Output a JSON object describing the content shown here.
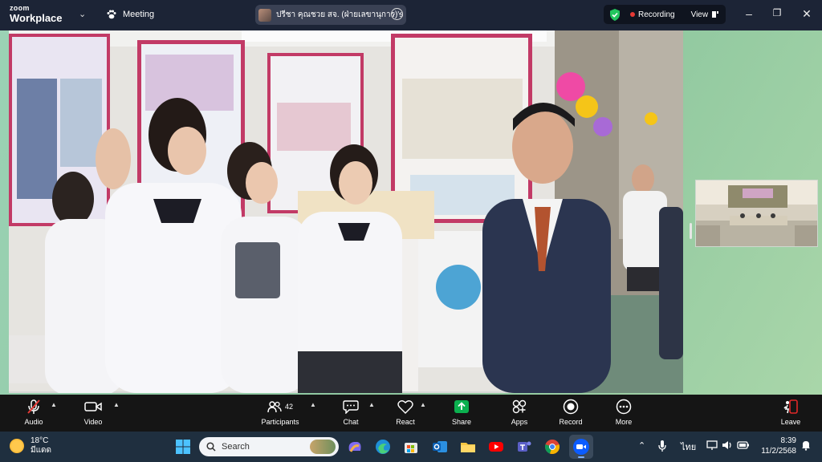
{
  "app": {
    "brand_top": "zoom",
    "brand_bottom": "Workplace",
    "meeting_label": "Meeting",
    "sharing_name": "ปรีชา คุณชวย สจ. (ฝ่ายเลขานุการ)'s",
    "more_glyph": "···",
    "recording_label": "Recording",
    "view_label": "View"
  },
  "toolbar": {
    "audio": "Audio",
    "video": "Video",
    "participants": "Participants",
    "participants_count": "42",
    "chat": "Chat",
    "react": "React",
    "share": "Share",
    "apps": "Apps",
    "record": "Record",
    "more": "More",
    "leave": "Leave"
  },
  "taskbar": {
    "temperature": "18°C",
    "weather": "มีแดด",
    "search_placeholder": "Search",
    "language": "ไทย",
    "time": "8:39",
    "date": "11/2/2568"
  },
  "colors": {
    "titlebar": "#1c2436",
    "toolbar": "#151515",
    "share_green": "#0bb04f",
    "record_red": "#e53935",
    "leave_red": "#e02828",
    "stage_bg": "#9bd2b5"
  }
}
